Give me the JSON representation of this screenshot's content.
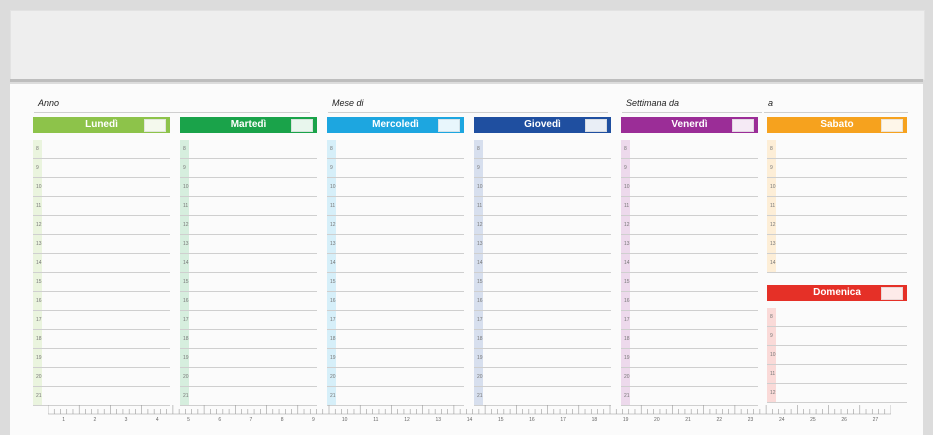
{
  "fields": {
    "anno": "Anno",
    "mese": "Mese di",
    "settimana": "Settimana da",
    "a": "a"
  },
  "days": [
    {
      "label": "Lunedì",
      "color": "#8dc34a",
      "hours": [
        "8",
        "9",
        "10",
        "11",
        "12",
        "13",
        "14",
        "15",
        "16",
        "17",
        "18",
        "19",
        "20",
        "21"
      ]
    },
    {
      "label": "Martedì",
      "color": "#1aa34a",
      "hours": [
        "8",
        "9",
        "10",
        "11",
        "12",
        "13",
        "14",
        "15",
        "16",
        "17",
        "18",
        "19",
        "20",
        "21"
      ]
    },
    {
      "label": "Mercoledì",
      "color": "#1da6e0",
      "hours": [
        "8",
        "9",
        "10",
        "11",
        "12",
        "13",
        "14",
        "15",
        "16",
        "17",
        "18",
        "19",
        "20",
        "21"
      ]
    },
    {
      "label": "Giovedì",
      "color": "#1f4fa0",
      "hours": [
        "8",
        "9",
        "10",
        "11",
        "12",
        "13",
        "14",
        "15",
        "16",
        "17",
        "18",
        "19",
        "20",
        "21"
      ]
    },
    {
      "label": "Venerdì",
      "color": "#9b2d97",
      "hours": [
        "8",
        "9",
        "10",
        "11",
        "12",
        "13",
        "14",
        "15",
        "16",
        "17",
        "18",
        "19",
        "20",
        "21"
      ]
    },
    {
      "label": "Sabato",
      "color": "#f6a21e",
      "hours": [
        "8",
        "9",
        "10",
        "11",
        "12",
        "13",
        "14"
      ]
    },
    {
      "label": "Domenica",
      "color": "#e53027",
      "hours": [
        "8",
        "9",
        "10",
        "11",
        "12"
      ]
    }
  ],
  "ruler_labels": [
    "1",
    "2",
    "3",
    "4",
    "5",
    "6",
    "7",
    "8",
    "9",
    "10",
    "11",
    "12",
    "13",
    "14",
    "15",
    "16",
    "17",
    "18",
    "19",
    "20",
    "21",
    "22",
    "23",
    "24",
    "25",
    "26",
    "27"
  ]
}
